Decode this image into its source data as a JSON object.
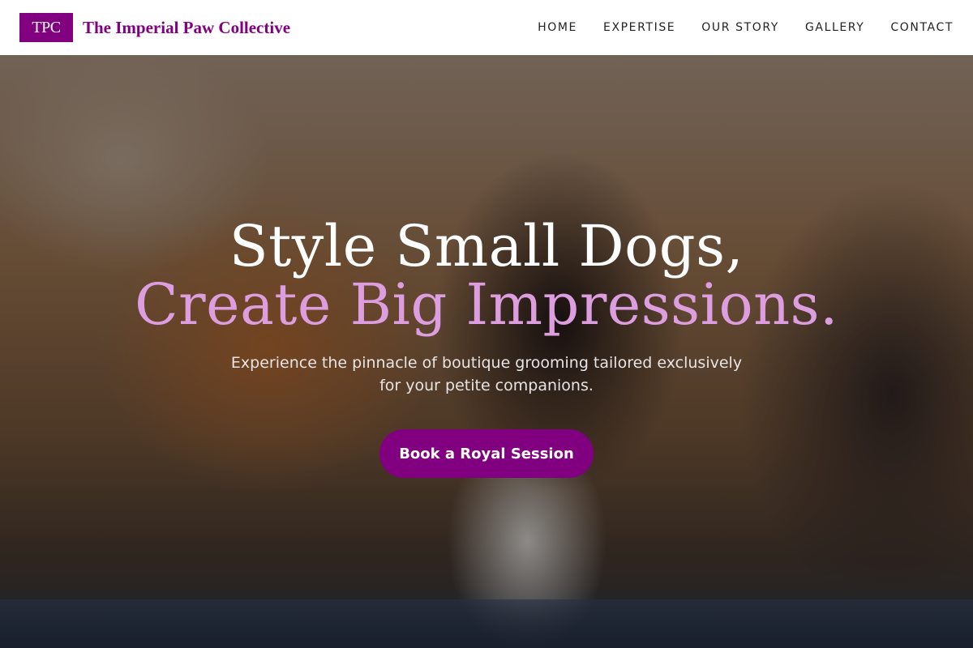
{
  "brand": {
    "logo_text": "TPC",
    "name": "The Imperial Paw Collective"
  },
  "nav": {
    "items": [
      {
        "label": "HOME"
      },
      {
        "label": "EXPERTISE"
      },
      {
        "label": "OUR STORY"
      },
      {
        "label": "GALLERY"
      },
      {
        "label": "CONTACT"
      }
    ]
  },
  "hero": {
    "headline_line1": "Style Small Dogs,",
    "headline_line2": "Create Big Impressions.",
    "subtitle": "Experience the pinnacle of boutique grooming tailored exclusively for your petite companions.",
    "cta_label": "Book a Royal Session"
  },
  "colors": {
    "brand_purple": "#800080",
    "accent_pink": "#dd9ee0"
  }
}
